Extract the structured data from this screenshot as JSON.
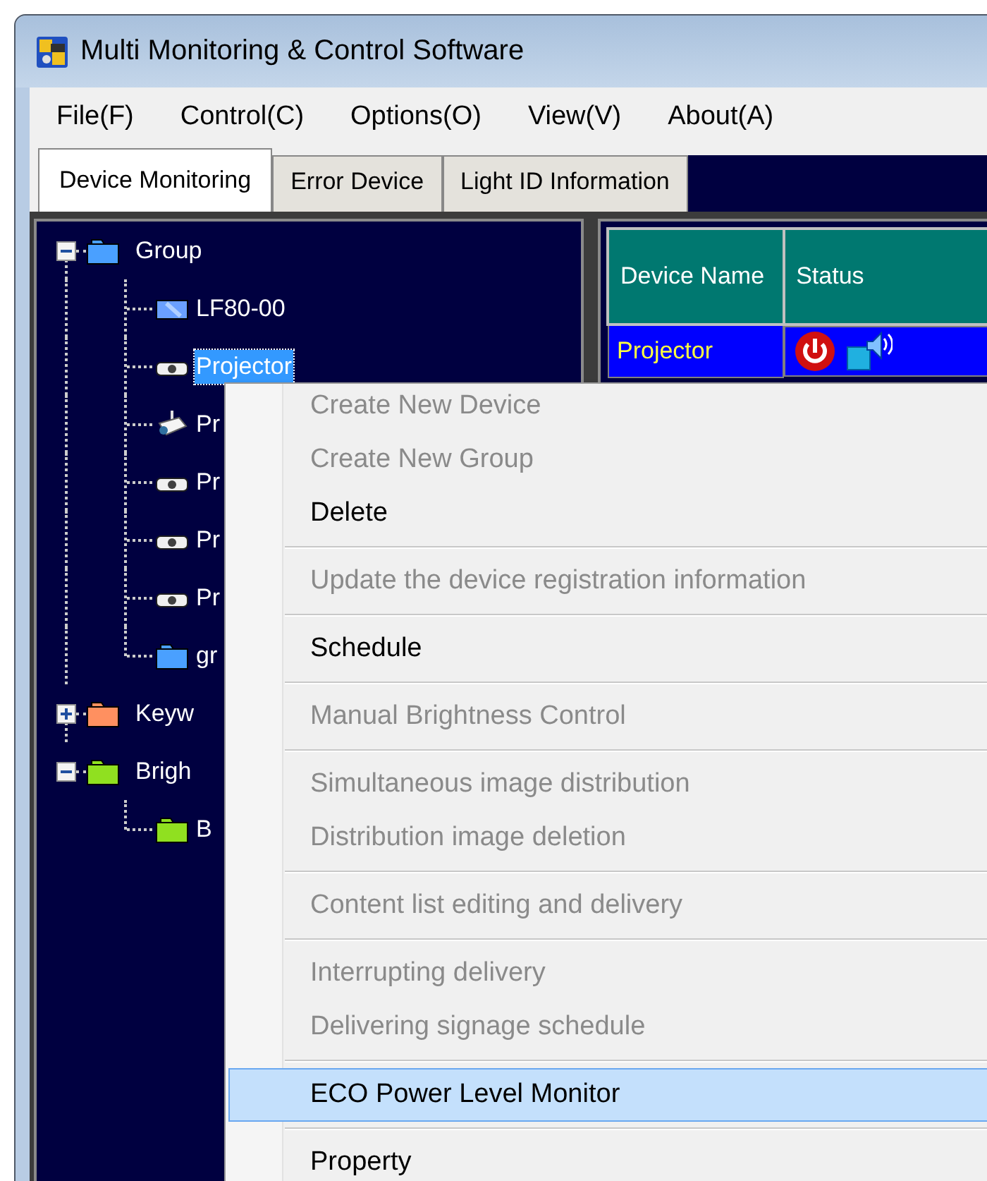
{
  "window": {
    "title": "Multi Monitoring & Control Software"
  },
  "menu_bar": [
    "File(F)",
    "Control(C)",
    "Options(O)",
    "View(V)",
    "About(A)"
  ],
  "tabs": [
    {
      "label": "Device Monitoring",
      "selected": true
    },
    {
      "label": "Error Device",
      "selected": false
    },
    {
      "label": "Light ID Information",
      "selected": false
    }
  ],
  "tree": [
    {
      "label": "Group",
      "kind": "group",
      "color": "#4aa0ff",
      "expanded": true,
      "selected": false,
      "children": [
        {
          "label": "LF80-00",
          "kind": "display",
          "selected": false
        },
        {
          "label": "Projector",
          "kind": "projector",
          "selected": true
        },
        {
          "label": "Pr",
          "kind": "camera",
          "selected": false
        },
        {
          "label": "Pr",
          "kind": "projector",
          "selected": false
        },
        {
          "label": "Pr",
          "kind": "projector",
          "selected": false
        },
        {
          "label": "Pr",
          "kind": "projector",
          "selected": false
        },
        {
          "label": "gr",
          "kind": "group",
          "color": "#4aa0ff",
          "selected": false
        }
      ]
    },
    {
      "label": "Keyw",
      "kind": "group",
      "color": "#ff9060",
      "expanded": false,
      "selected": false
    },
    {
      "label": "Brigh",
      "kind": "group",
      "color": "#90e020",
      "expanded": true,
      "selected": false,
      "children": [
        {
          "label": "B",
          "kind": "group",
          "color": "#90e020",
          "selected": false
        }
      ]
    }
  ],
  "table": {
    "columns": [
      "Device Name",
      "Status"
    ],
    "rows": [
      {
        "device_name": "Projector",
        "power_on": false
      }
    ]
  },
  "context_menu": [
    [
      {
        "label": "Create New Device",
        "disabled": true,
        "selected": false
      },
      {
        "label": "Create New Group",
        "disabled": true,
        "selected": false
      },
      {
        "label": "Delete",
        "disabled": false,
        "selected": false
      }
    ],
    [
      {
        "label": "Update the device registration information",
        "disabled": true,
        "selected": false
      }
    ],
    [
      {
        "label": "Schedule",
        "disabled": false,
        "selected": false
      }
    ],
    [
      {
        "label": "Manual Brightness Control",
        "disabled": true,
        "selected": false
      }
    ],
    [
      {
        "label": "Simultaneous image distribution",
        "disabled": true,
        "selected": false
      },
      {
        "label": "Distribution image deletion",
        "disabled": true,
        "selected": false
      }
    ],
    [
      {
        "label": "Content list editing and delivery",
        "disabled": true,
        "selected": false
      }
    ],
    [
      {
        "label": "Interrupting delivery",
        "disabled": true,
        "selected": false
      },
      {
        "label": "Delivering signage schedule",
        "disabled": true,
        "selected": false
      }
    ],
    [
      {
        "label": "ECO Power Level Monitor",
        "disabled": false,
        "selected": true
      }
    ],
    [
      {
        "label": "Property",
        "disabled": false,
        "selected": false
      }
    ]
  ]
}
